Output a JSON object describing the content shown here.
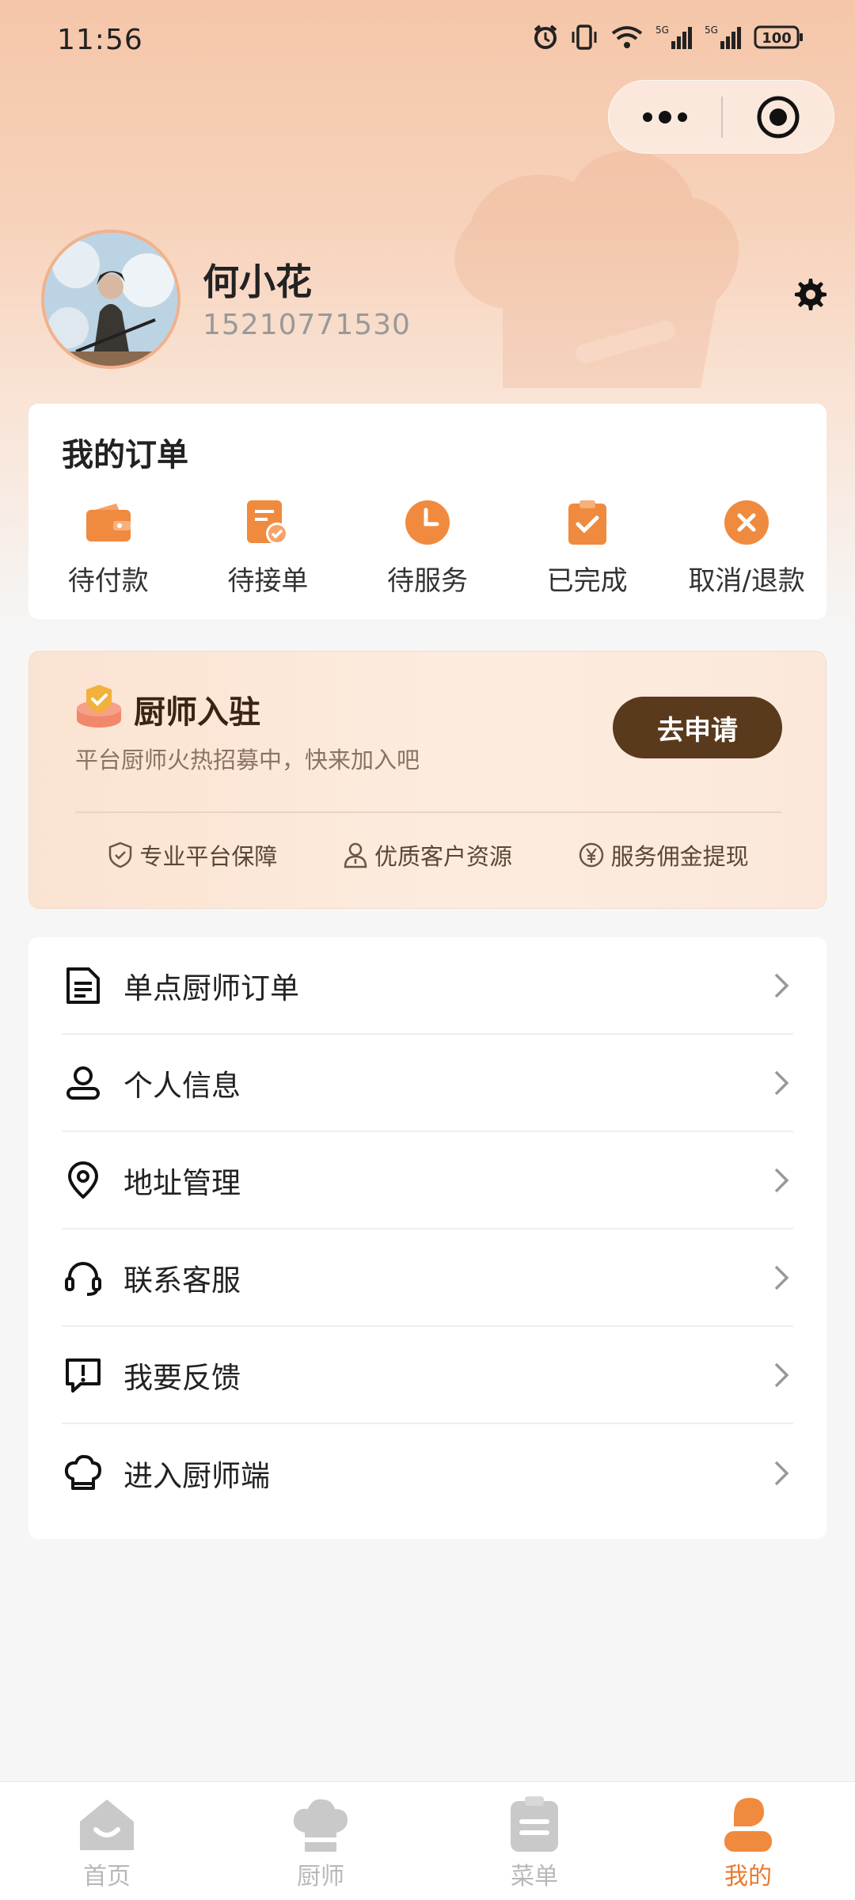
{
  "status_bar": {
    "time": "11:56",
    "battery": "100",
    "icons": [
      "alarm-icon",
      "vibrate-icon",
      "wifi-icon",
      "signal-5g-icon",
      "signal-5g-icon",
      "battery-icon"
    ]
  },
  "profile": {
    "name": "何小花",
    "phone": "15210771530"
  },
  "orders": {
    "title": "我的订单",
    "items": [
      {
        "label": "待付款",
        "icon": "wallet-icon"
      },
      {
        "label": "待接单",
        "icon": "doc-check-icon"
      },
      {
        "label": "待服务",
        "icon": "clock-icon"
      },
      {
        "label": "已完成",
        "icon": "clipboard-check-icon"
      },
      {
        "label": "取消/退款",
        "icon": "cancel-icon"
      }
    ]
  },
  "recruit": {
    "title": "厨师入驻",
    "subtitle": "平台厨师火热招募中，快来加入吧",
    "button": "去申请",
    "features": [
      {
        "label": "专业平台保障",
        "icon": "shield-check-icon"
      },
      {
        "label": "优质客户资源",
        "icon": "person-icon"
      },
      {
        "label": "服务佣金提现",
        "icon": "yen-icon"
      }
    ]
  },
  "menu": {
    "items": [
      {
        "label": "单点厨师订单",
        "icon": "document-icon"
      },
      {
        "label": "个人信息",
        "icon": "user-icon"
      },
      {
        "label": "地址管理",
        "icon": "location-pin-icon"
      },
      {
        "label": "联系客服",
        "icon": "headset-icon"
      },
      {
        "label": "我要反馈",
        "icon": "feedback-icon"
      },
      {
        "label": "进入厨师端",
        "icon": "chef-hat-icon"
      }
    ]
  },
  "tabbar": {
    "active": "我的",
    "tabs": [
      {
        "label": "首页",
        "icon": "home-icon"
      },
      {
        "label": "厨师",
        "icon": "chef-hat-icon"
      },
      {
        "label": "菜单",
        "icon": "menu-clipboard-icon"
      },
      {
        "label": "我的",
        "icon": "profile-icon"
      }
    ]
  },
  "colors": {
    "accent": "#f08a3e",
    "accent_active_tab": "#e8792f",
    "button_dark": "#5a3a1c",
    "tab_inactive": "#b8b8b8"
  }
}
